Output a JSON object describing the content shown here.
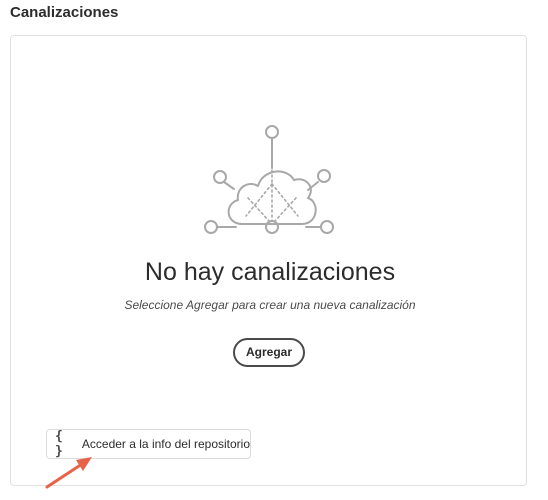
{
  "section": {
    "title": "Canalizaciones"
  },
  "empty_state": {
    "illustration_icon": "cloud-network-icon",
    "heading": "No hay canalizaciones",
    "description": "Seleccione Agregar para crear una nueva canalización",
    "add_button_label": "Agregar"
  },
  "repo_access": {
    "icon": "{ }",
    "icon_name": "code-braces-icon",
    "label": "Acceder a la info del repositorio"
  },
  "annotation": {
    "icon_name": "red-arrow-icon",
    "color": "#e8624a"
  },
  "colors": {
    "illustration_stroke": "#a8a8a8",
    "card_border": "#e1e1e1"
  }
}
